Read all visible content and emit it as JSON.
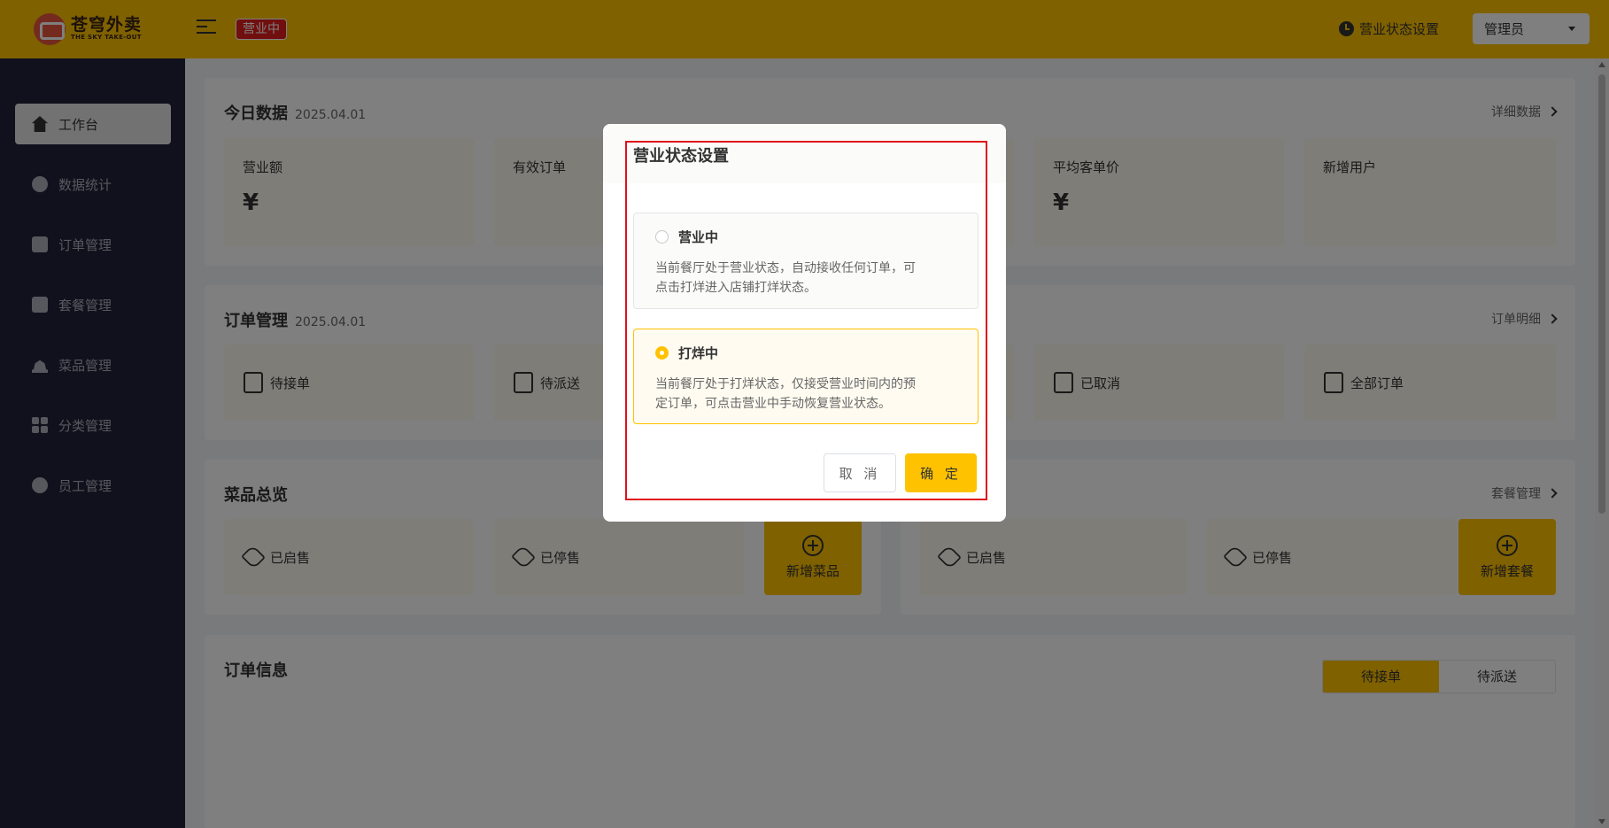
{
  "header": {
    "logo_cn": "苍穹外卖",
    "logo_en": "THE SKY TAKE-OUT",
    "status_tag": "营业中",
    "status_setting_label": "营业状态设置",
    "admin_label": "管理员"
  },
  "sidebar": {
    "items": [
      {
        "label": "工作台",
        "icon": "home-icon",
        "active": true
      },
      {
        "label": "数据统计",
        "icon": "chart-icon"
      },
      {
        "label": "订单管理",
        "icon": "clipboard-icon"
      },
      {
        "label": "套餐管理",
        "icon": "gift-icon"
      },
      {
        "label": "菜品管理",
        "icon": "dish-cover-icon"
      },
      {
        "label": "分类管理",
        "icon": "grid-icon"
      },
      {
        "label": "员工管理",
        "icon": "employee-icon"
      }
    ]
  },
  "today": {
    "title": "今日数据",
    "date": "2025.04.01",
    "link": "详细数据",
    "cards": [
      {
        "label": "营业额",
        "value": "¥"
      },
      {
        "label": "有效订单",
        "value": ""
      },
      {
        "label": "平均客单价",
        "value": "¥"
      },
      {
        "label": "新增用户",
        "value": ""
      }
    ]
  },
  "orders": {
    "title": "订单管理",
    "date": "2025.04.01",
    "link": "订单明细",
    "items": [
      "待接单",
      "待派送",
      "已取消",
      "全部订单"
    ]
  },
  "dishes": {
    "title": "菜品总览",
    "link": "套餐管理",
    "dish_items": [
      "已启售",
      "已停售"
    ],
    "add_dish": "新增菜品",
    "set_items": [
      "已启售",
      "已停售"
    ],
    "add_set": "新增套餐"
  },
  "order_info": {
    "title": "订单信息",
    "tabs": [
      "待接单",
      "待派送"
    ]
  },
  "dialog": {
    "title": "营业状态设置",
    "options": [
      {
        "label": "营业中",
        "desc_line1": "当前餐厅处于营业状态，自动接收任何订单，可",
        "desc_line2": "点击打烊进入店铺打烊状态。",
        "checked": false
      },
      {
        "label": "打烊中",
        "desc_line1": "当前餐厅处于打烊状态，仅接受营业时间内的预",
        "desc_line2": "定订单，可点击营业中手动恢复营业状态。",
        "checked": true
      }
    ],
    "cancel": "取 消",
    "confirm": "确 定"
  },
  "colors": {
    "brand": "#ffc200",
    "sidebar_bg": "#22233a",
    "status_tag": "#e21c1c",
    "highlight": "#e0101a"
  }
}
